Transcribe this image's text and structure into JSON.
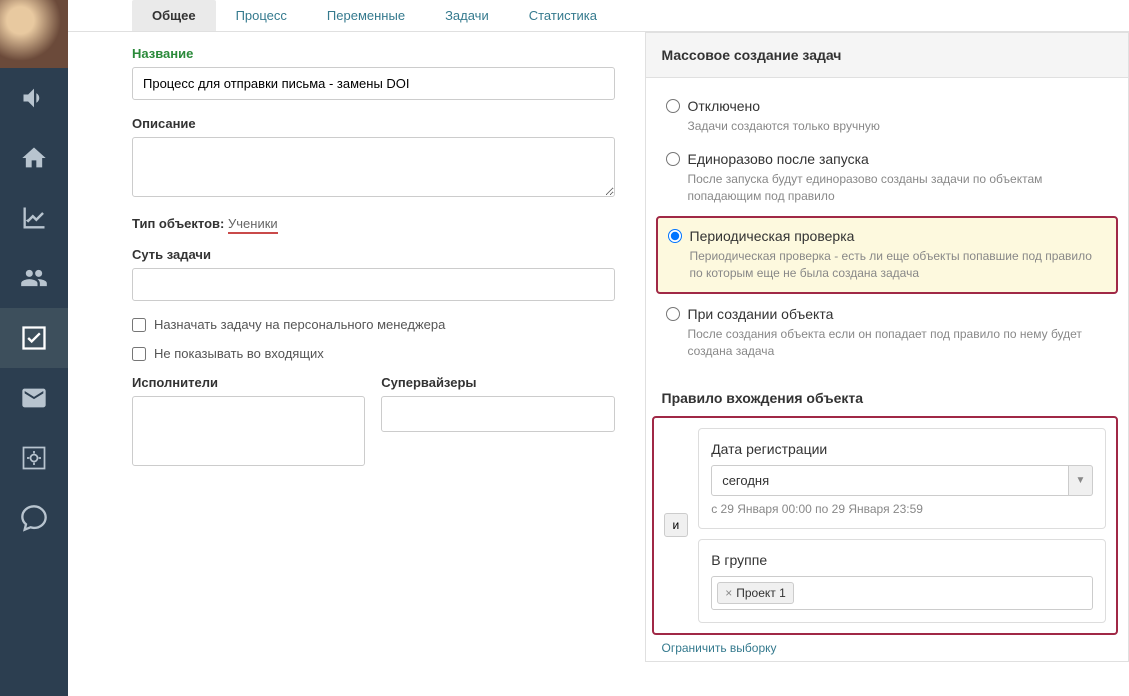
{
  "tabs": [
    {
      "label": "Общее",
      "active": true
    },
    {
      "label": "Процесс",
      "active": false
    },
    {
      "label": "Переменные",
      "active": false
    },
    {
      "label": "Задачи",
      "active": false
    },
    {
      "label": "Статистика",
      "active": false
    }
  ],
  "left": {
    "name_label": "Название",
    "name_value": "Процесс для отправки письма - замены DOI",
    "desc_label": "Описание",
    "desc_value": "",
    "obj_type_label": "Тип объектов:",
    "obj_type_value": "Ученики",
    "essence_label": "Суть задачи",
    "essence_value": "",
    "cb_assign": "Назначать задачу на персонального менеджера",
    "cb_hide": "Не показывать во входящих",
    "performers_label": "Исполнители",
    "supervisors_label": "Супервайзеры"
  },
  "right": {
    "panel_title": "Массовое создание задач",
    "radios": [
      {
        "label": "Отключено",
        "desc": "Задачи создаются только вручную",
        "checked": false
      },
      {
        "label": "Единоразово после запуска",
        "desc": "После запуска будут единоразово созданы задачи по объектам попадающим под правило",
        "checked": false
      },
      {
        "label": "Периодическая проверка",
        "desc": "Периодическая проверка - есть ли еще объекты попавшие под правило по которым еще не была создана задача",
        "checked": true
      },
      {
        "label": "При создании объекта",
        "desc": "После создания объекта если он попадает под правило по нему будет создана задача",
        "checked": false
      }
    ],
    "rule_title": "Правило вхождения объекта",
    "and_label": "и",
    "cond1_title": "Дата регистрации",
    "cond1_value": "сегодня",
    "cond1_note": "с 29 Января 00:00 по 29 Января 23:59",
    "cond2_title": "В группе",
    "cond2_tag": "Проект 1",
    "limit_link": "Ограничить выборку"
  }
}
